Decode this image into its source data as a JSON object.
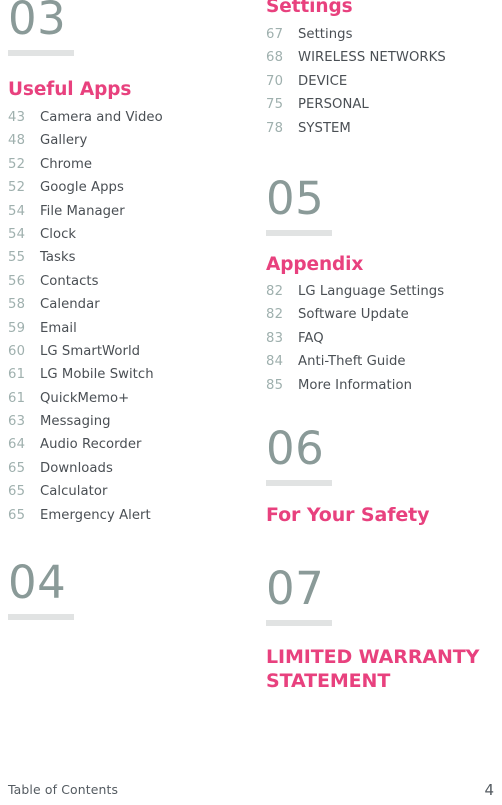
{
  "document": {
    "footer_label": "Table of Contents",
    "footer_page_number": "4",
    "accent_pink": "#E8417E",
    "chapter_num_color": "#8A9A98",
    "rule_color": "#E1E3E3",
    "page_num_color": "#9FB0AE",
    "label_color": "#4A4F54"
  },
  "left_column": {
    "chapter_03": {
      "number": "03",
      "title": "Useful Apps",
      "entries": [
        {
          "page": "43",
          "label": "Camera and Video"
        },
        {
          "page": "48",
          "label": "Gallery"
        },
        {
          "page": "52",
          "label": "Chrome"
        },
        {
          "page": "52",
          "label": "Google Apps"
        },
        {
          "page": "54",
          "label": "File Manager"
        },
        {
          "page": "54",
          "label": "Clock"
        },
        {
          "page": "55",
          "label": "Tasks"
        },
        {
          "page": "56",
          "label": "Contacts"
        },
        {
          "page": "58",
          "label": "Calendar"
        },
        {
          "page": "59",
          "label": "Email"
        },
        {
          "page": "60",
          "label": "LG SmartWorld"
        },
        {
          "page": "61",
          "label": "LG Mobile Switch"
        },
        {
          "page": "61",
          "label": "QuickMemo+"
        },
        {
          "page": "63",
          "label": "Messaging"
        },
        {
          "page": "64",
          "label": "Audio Recorder"
        },
        {
          "page": "65",
          "label": "Downloads"
        },
        {
          "page": "65",
          "label": "Calculator"
        },
        {
          "page": "65",
          "label": "Emergency Alert"
        }
      ]
    },
    "chapter_04": {
      "number": "04"
    }
  },
  "right_column": {
    "chapter_04_continued": {
      "title": "Settings",
      "entries": [
        {
          "page": "67",
          "label": "Settings"
        },
        {
          "page": "68",
          "label": "WIRELESS NETWORKS"
        },
        {
          "page": "70",
          "label": "DEVICE"
        },
        {
          "page": "75",
          "label": "PERSONAL"
        },
        {
          "page": "78",
          "label": "SYSTEM"
        }
      ]
    },
    "chapter_05": {
      "number": "05",
      "title": "Appendix",
      "entries": [
        {
          "page": "82",
          "label": "LG Language Settings"
        },
        {
          "page": "82",
          "label": "Software Update"
        },
        {
          "page": "83",
          "label": "FAQ"
        },
        {
          "page": "84",
          "label": "Anti-Theft Guide"
        },
        {
          "page": "85",
          "label": "More Information"
        }
      ]
    },
    "chapter_06": {
      "number": "06",
      "title": "For Your Safety"
    },
    "chapter_07": {
      "number": "07",
      "title_line1": "LIMITED WARRANTY",
      "title_line2": "STATEMENT"
    }
  }
}
